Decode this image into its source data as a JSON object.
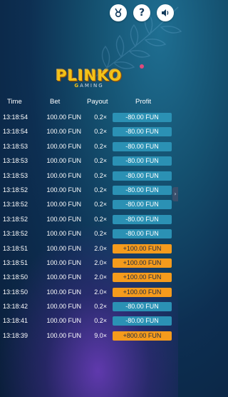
{
  "header": {
    "icons": [
      {
        "name": "medal-icon",
        "glyph": "🏅"
      },
      {
        "name": "help-icon",
        "glyph": "?"
      },
      {
        "name": "sound-icon",
        "glyph": "🔊"
      }
    ]
  },
  "logo": {
    "title": "PLINKO",
    "sub_accent": "G",
    "sub_rest": "AMING"
  },
  "table": {
    "headers": {
      "time": "Time",
      "bet": "Bet",
      "payout": "Payout",
      "profit": "Profit"
    },
    "rows": [
      {
        "time": "13:18:54",
        "bet": "100.00 FUN",
        "payout": "0.2×",
        "profit": "-80.00 FUN",
        "positive": false
      },
      {
        "time": "13:18:54",
        "bet": "100.00 FUN",
        "payout": "0.2×",
        "profit": "-80.00 FUN",
        "positive": false
      },
      {
        "time": "13:18:53",
        "bet": "100.00 FUN",
        "payout": "0.2×",
        "profit": "-80.00 FUN",
        "positive": false
      },
      {
        "time": "13:18:53",
        "bet": "100.00 FUN",
        "payout": "0.2×",
        "profit": "-80.00 FUN",
        "positive": false
      },
      {
        "time": "13:18:53",
        "bet": "100.00 FUN",
        "payout": "0.2×",
        "profit": "-80.00 FUN",
        "positive": false
      },
      {
        "time": "13:18:52",
        "bet": "100.00 FUN",
        "payout": "0.2×",
        "profit": "-80.00 FUN",
        "positive": false
      },
      {
        "time": "13:18:52",
        "bet": "100.00 FUN",
        "payout": "0.2×",
        "profit": "-80.00 FUN",
        "positive": false
      },
      {
        "time": "13:18:52",
        "bet": "100.00 FUN",
        "payout": "0.2×",
        "profit": "-80.00 FUN",
        "positive": false
      },
      {
        "time": "13:18:52",
        "bet": "100.00 FUN",
        "payout": "0.2×",
        "profit": "-80.00 FUN",
        "positive": false
      },
      {
        "time": "13:18:51",
        "bet": "100.00 FUN",
        "payout": "2.0×",
        "profit": "+100.00 FUN",
        "positive": true
      },
      {
        "time": "13:18:51",
        "bet": "100.00 FUN",
        "payout": "2.0×",
        "profit": "+100.00 FUN",
        "positive": true
      },
      {
        "time": "13:18:50",
        "bet": "100.00 FUN",
        "payout": "2.0×",
        "profit": "+100.00 FUN",
        "positive": true
      },
      {
        "time": "13:18:50",
        "bet": "100.00 FUN",
        "payout": "2.0×",
        "profit": "+100.00 FUN",
        "positive": true
      },
      {
        "time": "13:18:42",
        "bet": "100.00 FUN",
        "payout": "0.2×",
        "profit": "-80.00 FUN",
        "positive": false
      },
      {
        "time": "13:18:41",
        "bet": "100.00 FUN",
        "payout": "0.2×",
        "profit": "-80.00 FUN",
        "positive": false
      },
      {
        "time": "13:18:39",
        "bet": "100.00 FUN",
        "payout": "9.0×",
        "profit": "+800.00 FUN",
        "positive": true
      }
    ]
  },
  "side_tab": {
    "glyph": "›"
  },
  "colors": {
    "loss": "#2b91b4",
    "win": "#f59b1c",
    "logo": "#f3c316"
  }
}
